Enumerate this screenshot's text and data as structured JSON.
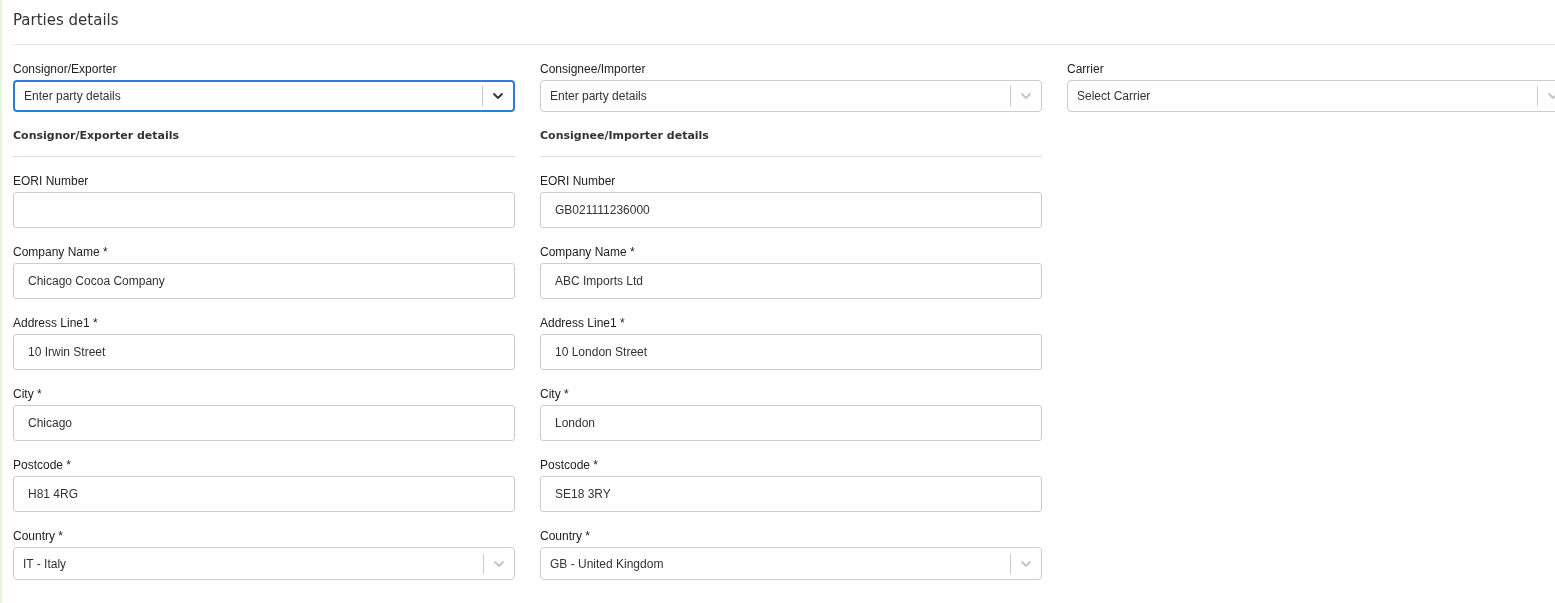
{
  "title": "Parties details",
  "parties": [
    {
      "select": {
        "label": "Consignor/Exporter",
        "placeholder": "Enter party details",
        "focused": true
      },
      "details_title": "Consignor/Exporter details",
      "fields": [
        {
          "kind": "text",
          "label": "EORI Number"
        },
        {
          "kind": "text",
          "label": "Company Name *",
          "value": "Chicago Cocoa Company"
        },
        {
          "kind": "text",
          "label": "Address Line1 *",
          "value": "10 Irwin Street"
        },
        {
          "kind": "text",
          "label": "City *",
          "value": "Chicago"
        },
        {
          "kind": "text",
          "label": "Postcode *",
          "value": "H81 4RG"
        },
        {
          "kind": "select",
          "label": "Country *",
          "value": "IT - Italy"
        }
      ]
    },
    {
      "select": {
        "label": "Consignee/Importer",
        "placeholder": "Enter party details",
        "focused": false
      },
      "details_title": "Consignee/Importer details",
      "fields": [
        {
          "kind": "text",
          "label": "EORI Number",
          "value": "GB021111236000"
        },
        {
          "kind": "text",
          "label": "Company Name *",
          "value": "ABC Imports Ltd"
        },
        {
          "kind": "text",
          "label": "Address Line1 *",
          "value": "10 London Street"
        },
        {
          "kind": "text",
          "label": "City *",
          "value": "London"
        },
        {
          "kind": "text",
          "label": "Postcode *",
          "value": "SE18 3RY"
        },
        {
          "kind": "select",
          "label": "Country *",
          "value": "GB - United Kingdom"
        }
      ]
    }
  ],
  "carrier": {
    "label": "Carrier",
    "placeholder": "Select Carrier",
    "focused": false
  }
}
